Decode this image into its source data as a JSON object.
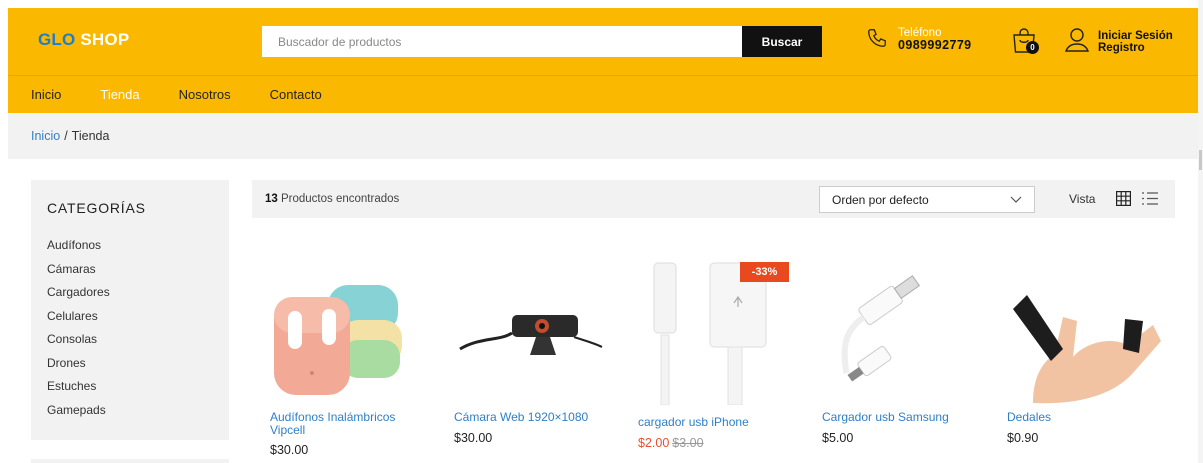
{
  "header": {
    "logo_part1": "GLO",
    "logo_part2": "SHOP",
    "search_placeholder": "Buscador de productos",
    "search_button": "Buscar",
    "phone_label": "Teléfono",
    "phone_number": "0989992779",
    "cart_count": "0",
    "login_label": "Iniciar Sesión",
    "register_label": "Registro"
  },
  "nav": {
    "items": [
      {
        "label": "Inicio"
      },
      {
        "label": "Tienda"
      },
      {
        "label": "Nosotros"
      },
      {
        "label": "Contacto"
      }
    ],
    "active_item": "Tienda"
  },
  "breadcrumb": {
    "home": "Inicio",
    "separator": "/",
    "current": "Tienda"
  },
  "sidebar": {
    "title": "CATEGORÍAS",
    "categories": [
      "Audífonos",
      "Cámaras",
      "Cargadores",
      "Celulares",
      "Consolas",
      "Drones",
      "Estuches",
      "Gamepads"
    ]
  },
  "toolbar": {
    "count": "13",
    "count_text": "Productos encontrados",
    "sort_value": "Orden por defecto",
    "view_label": "Vista",
    "view_mode": "grid"
  },
  "products": [
    {
      "name_line1": "Audífonos Inalámbricos",
      "name_line2": "Vipcell",
      "price": "$30.00",
      "image_icon": "earbuds-image"
    },
    {
      "name_line1": "Cámara Web 1920×1080",
      "price": "$30.00",
      "image_icon": "webcam-image"
    },
    {
      "name_line1": "cargador usb iPhone",
      "sale_price": "$2.00",
      "old_price": "$3.00",
      "discount": "-33%",
      "image_icon": "lightning-cable-image"
    },
    {
      "name_line1": "Cargador usb Samsung",
      "price": "$5.00",
      "image_icon": "micro-usb-cable-image"
    },
    {
      "name_line1": "Dedales",
      "price": "$0.90",
      "image_icon": "finger-sleeve-image"
    }
  ],
  "colors": {
    "brand_yellow": "#fbb800",
    "logo_blue": "#1a7fd0",
    "link_blue": "#2f7fc8",
    "sale_red": "#e85030",
    "discount_badge": "#e8491d"
  }
}
